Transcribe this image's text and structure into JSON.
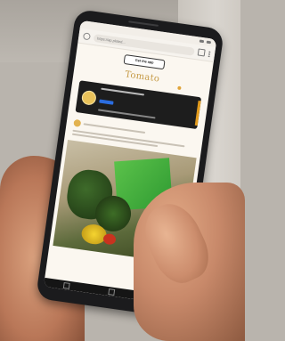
{
  "scene": {
    "description_colors": {
      "wall": "#cfcac3",
      "skin": "#c8896a",
      "phone": "#1b1b1d"
    }
  },
  "browser": {
    "url": "https://ap.plated...",
    "open_app_label": "Get the app"
  },
  "site": {
    "brand": "Tomato",
    "accent": "#c59a45"
  },
  "icons": {
    "info": "info-icon",
    "tabs": "tabs-icon",
    "menu": "menu-icon"
  }
}
